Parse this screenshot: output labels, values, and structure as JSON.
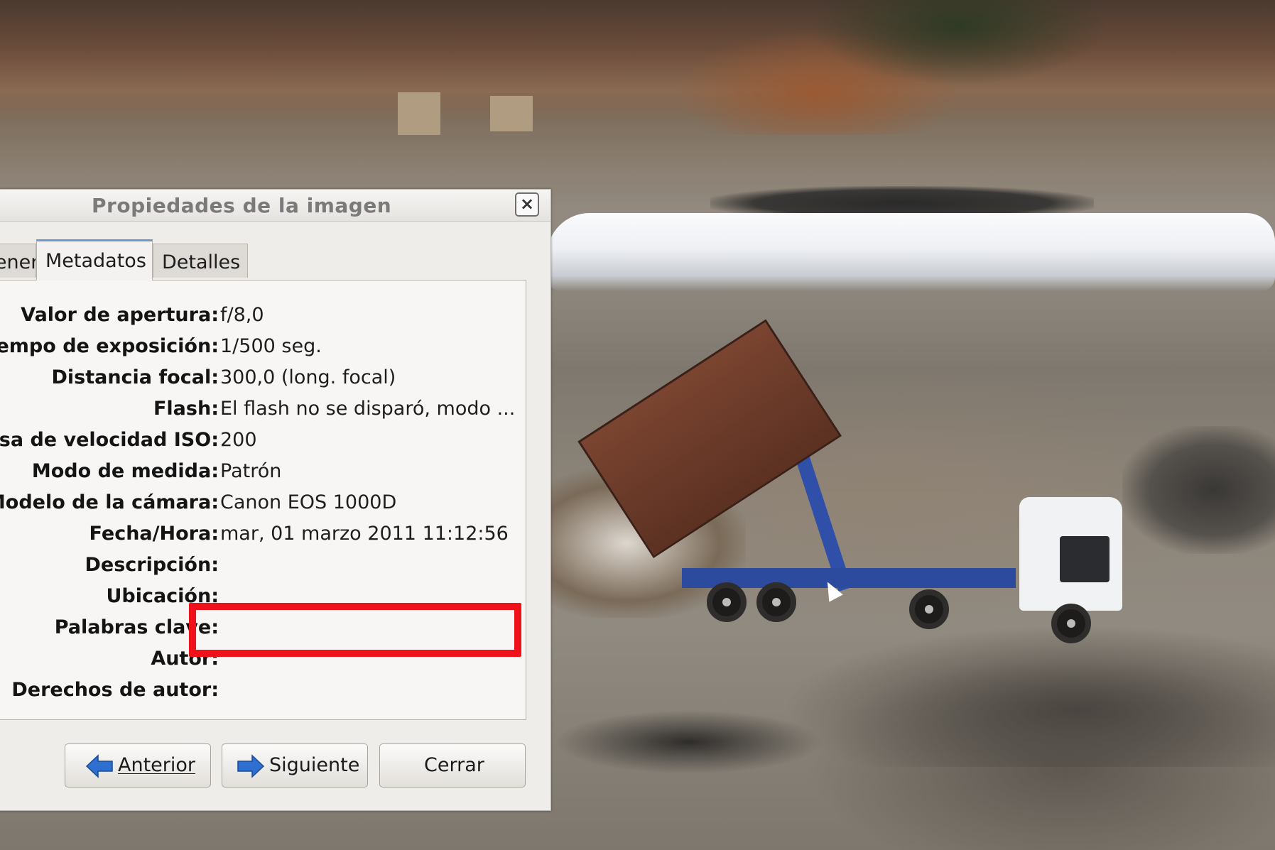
{
  "dialog": {
    "title": "Propiedades de la imagen",
    "close_glyph": "×",
    "tabs": [
      {
        "label": "General"
      },
      {
        "label": "Metadatos"
      },
      {
        "label": "Detalles"
      }
    ],
    "metadata_rows": [
      {
        "label": "Valor de apertura:",
        "value": "f/8,0"
      },
      {
        "label": "Tiempo de exposición:",
        "value": "1/500 seg."
      },
      {
        "label": "Distancia focal:",
        "value": "300,0 (long. focal)"
      },
      {
        "label": "Flash:",
        "value": "El flash no se disparó, modo ..."
      },
      {
        "label": "Tasa de velocidad ISO:",
        "value": "200"
      },
      {
        "label": "Modo de medida:",
        "value": "Patrón"
      },
      {
        "label": "Modelo de la cámara:",
        "value": "Canon EOS 1000D"
      },
      {
        "label": "Fecha/Hora:",
        "value": "mar, 01 marzo 2011  11:12:56"
      },
      {
        "label": "Descripción:",
        "value": ""
      },
      {
        "label": "Ubicación:",
        "value": ""
      },
      {
        "label": "Palabras clave:",
        "value": ""
      },
      {
        "label": "Autor:",
        "value": ""
      },
      {
        "label": "Derechos de autor:",
        "value": ""
      }
    ],
    "buttons": {
      "previous": "Anterior",
      "next": "Siguiente",
      "close": "Cerrar"
    }
  },
  "colors": {
    "highlight": "#f0121b",
    "active_tab_accent": "#6f95c9",
    "arrow_blue": "#2f6fd0"
  },
  "icons": {
    "previous": "arrow-left-icon",
    "next": "arrow-right-icon"
  }
}
